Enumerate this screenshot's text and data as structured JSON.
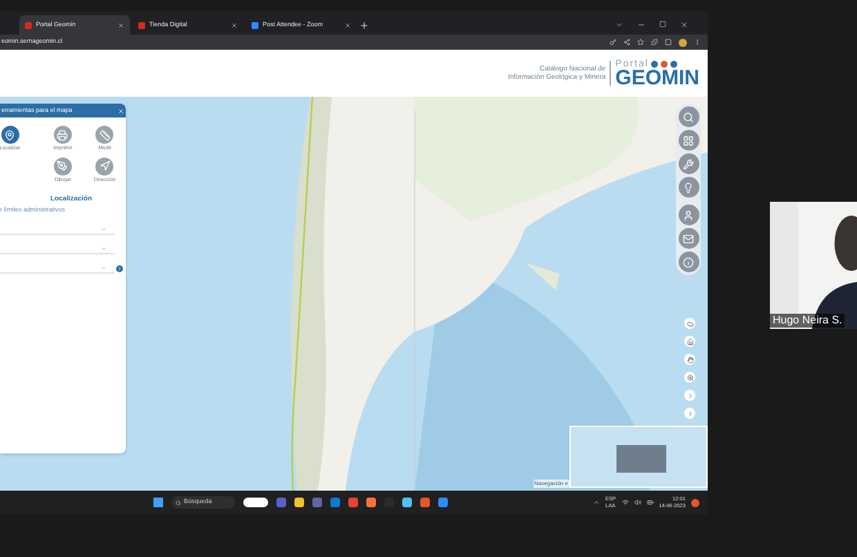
{
  "browser": {
    "tabs": [
      {
        "title": "Portal Geomin",
        "selected": true
      },
      {
        "title": "Tienda Digital",
        "selected": false
      },
      {
        "title": "Post Attendee - Zoom",
        "selected": false
      }
    ],
    "address": "eomin.sernageomin.cl"
  },
  "header": {
    "catalog_lines": [
      "Catálogo Nacional de",
      "Información Geológica y Minera"
    ],
    "logo_top": "Portal",
    "logo_main": "GEOMIN"
  },
  "tools_panel": {
    "title": "erramientas para el mapa",
    "tools": [
      {
        "label": "Localizar",
        "kind": "pin",
        "selected": true
      },
      {
        "label": "Imprimir",
        "kind": "print",
        "selected": false
      },
      {
        "label": "Medir",
        "kind": "ruler",
        "selected": false
      },
      {
        "label": "Dibujar",
        "kind": "draw",
        "selected": false
      },
      {
        "label": "Dirección",
        "kind": "direction",
        "selected": false
      }
    ],
    "section_title": "Localización",
    "section_subtitle": "r límites administrativos"
  },
  "map": {
    "attribution": "Navegación e"
  },
  "taskbar": {
    "search_placeholder": "Búsqueda",
    "language": "ESP",
    "layout": "LAA",
    "time": "12:01",
    "date": "14-06-2023"
  },
  "participant": {
    "name": "Hugo Neira S."
  }
}
